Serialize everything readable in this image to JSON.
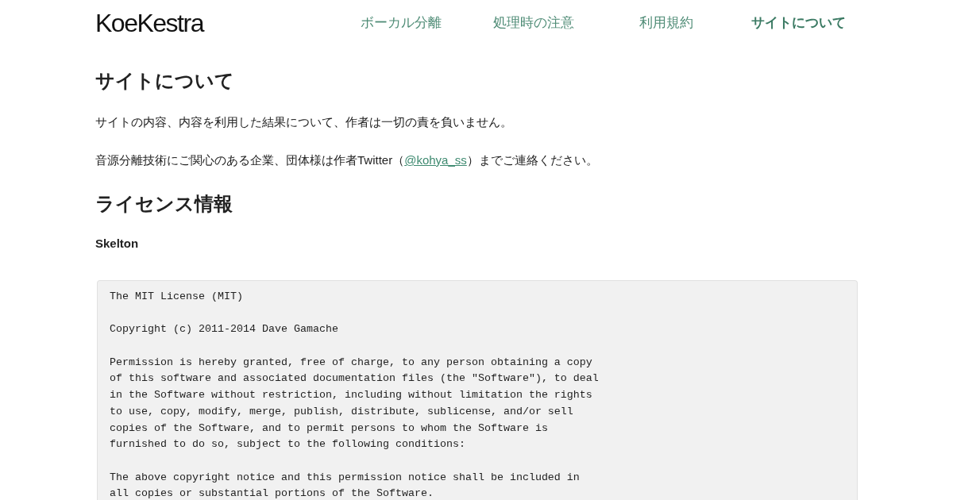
{
  "header": {
    "logo": "KoeKestra",
    "nav": [
      {
        "label": "ボーカル分離",
        "selected": false
      },
      {
        "label": "処理時の注意",
        "selected": false
      },
      {
        "label": "利用規約",
        "selected": false
      },
      {
        "label": "サイトについて",
        "selected": true
      }
    ]
  },
  "about": {
    "heading": "サイトについて",
    "paragraphs": [
      {
        "text": "サイトの内容、内容を利用した結果について、作者は一切の責を負いません。"
      },
      {
        "text": "音源分離技術にご関心のある企業、団体様は作者Twitter（",
        "link": "@kohya_ss",
        "text_after": "）までご連絡ください。"
      }
    ]
  },
  "license": {
    "heading": "ライセンス情報",
    "subheading": "Skelton",
    "code_paragraphs": [
      [
        "The MIT License (MIT)"
      ],
      [
        "Copyright (c) 2011-2014 Dave Gamache"
      ],
      [
        "Permission is hereby granted, free of charge, to any person obtaining a copy",
        "of this software and associated documentation files (the \"Software\"), to deal",
        "in the Software without restriction, including without limitation the rights",
        "to use, copy, modify, merge, publish, distribute, sublicense, and/or sell",
        "copies of the Software, and to permit persons to whom the Software is",
        "furnished to do so, subject to the following conditions:"
      ],
      [
        "The above copyright notice and this permission notice shall be included in",
        "all copies or substantial portions of the Software."
      ]
    ]
  }
}
